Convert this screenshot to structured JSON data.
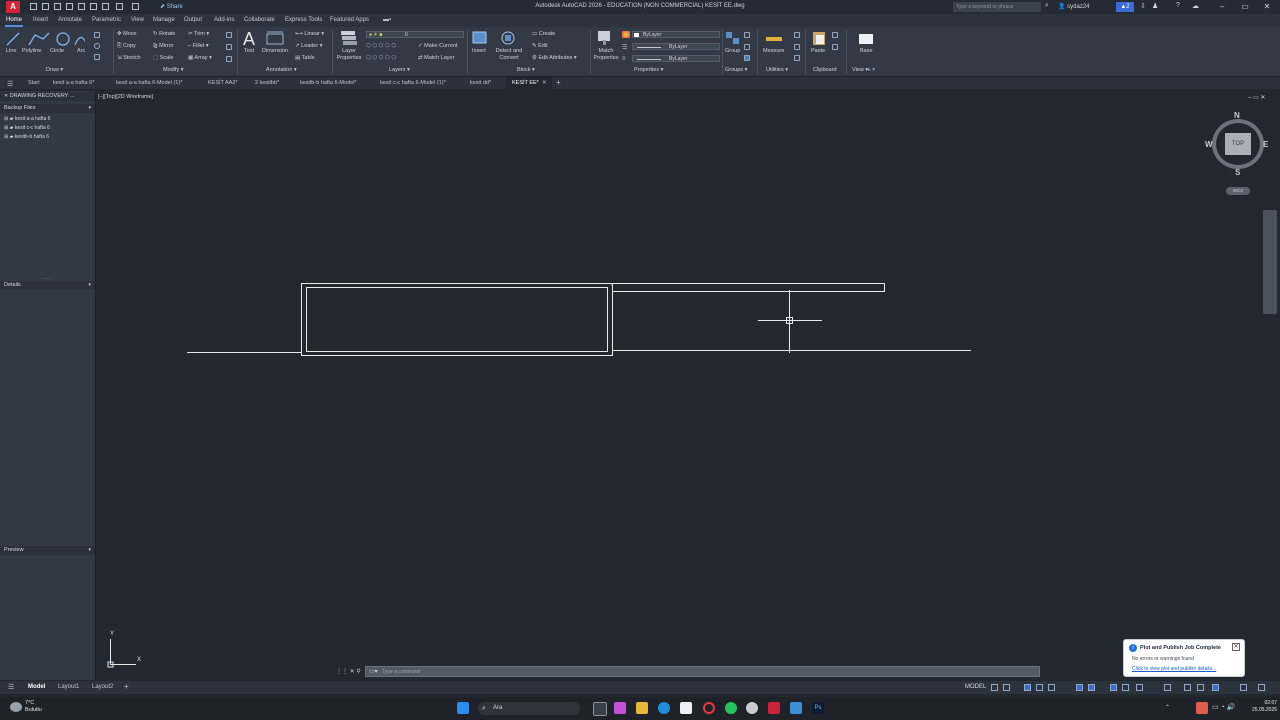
{
  "titlebar": {
    "title": "Autodesk AutoCAD 2026 - EDUCATION (NON COMMERCIAL)   KESİT EE.dwg",
    "share_label": "Share",
    "search_placeholder": "Type a keyword or phrase",
    "user": "sydaz24",
    "badge": "2"
  },
  "ribbon_tabs": [
    "Home",
    "Insert",
    "Annotate",
    "Parametric",
    "View",
    "Manage",
    "Output",
    "Add-ins",
    "Collaborate",
    "Express Tools",
    "Featured Apps"
  ],
  "ribbon": {
    "draw": {
      "line": "Line",
      "polyline": "Polyline",
      "circle": "Circle",
      "arc": "Arc",
      "panel": "Draw ▾"
    },
    "modify": {
      "move": "Move",
      "rotate": "Rotate",
      "trim": "Trim ▾",
      "copy": "Copy",
      "mirror": "Mirror",
      "fillet": "Fillet ▾",
      "stretch": "Stretch",
      "scale": "Scale",
      "array": "Array ▾",
      "panel": "Modify ▾"
    },
    "annotation": {
      "text": "Text",
      "dimension": "Dimension",
      "linear": "Linear ▾",
      "leader": "Leader ▾",
      "table": "Table",
      "panel": "Annotation ▾"
    },
    "layers": {
      "layer_properties": "Layer Properties",
      "layer_value": "0",
      "make_current": "Make Current",
      "match_layer": "Match Layer",
      "panel": "Layers ▾"
    },
    "block": {
      "insert": "Insert",
      "detect": "Detect and Convert",
      "create": "Create",
      "edit": "Edit",
      "edit_attributes": "Edit Attributes ▾",
      "panel": "Block ▾"
    },
    "properties": {
      "match": "Match Properties",
      "bylayer1": "ByLayer",
      "bylayer2": "ByLayer",
      "bylayer3": "ByLayer",
      "panel": "Properties ▾"
    },
    "groups": {
      "group": "Group",
      "panel": "Groups ▾"
    },
    "utilities": {
      "measure": "Measure",
      "panel": "Utilities ▾"
    },
    "clipboard": {
      "paste": "Paste",
      "panel": "Clipboard"
    },
    "view": {
      "base": "Base",
      "panel": "View ▾"
    }
  },
  "file_tabs": [
    "Start",
    "kesit a-a hafta 6*",
    "kesit a-a hafta 6-Model (1)*",
    "KESİT AA2*",
    "2 kesitbb*",
    "kesitb-b hafta 6-Model*",
    "kesit c-c hafta 6-Model (1)*",
    "kesit dd*",
    "KESİT EE*"
  ],
  "palette": {
    "title": "DRAWING RECOVERY ...",
    "backup_header": "Backup Files",
    "files": [
      "kesit a-a hafta 6",
      "kesit c-c hafta 6",
      "kesitb-b hafta 6"
    ],
    "details_header": "Details",
    "preview_header": "Preview"
  },
  "viewport": {
    "label": "[−][Top][2D Wireframe]"
  },
  "viewcube": {
    "n": "N",
    "s": "S",
    "e": "E",
    "w": "W",
    "top": "TOP",
    "wcs": "WCS"
  },
  "ucs": {
    "x": "X",
    "y": "Y"
  },
  "command": {
    "placeholder": "Type a command"
  },
  "layout_tabs": [
    "Model",
    "Layout1",
    "Layout2"
  ],
  "status": {
    "model": "MODEL"
  },
  "notification": {
    "title": "Plot and Publish Job Complete",
    "message": "No errors or warnings found",
    "link": "Click to view plot and publish details..."
  },
  "taskbar": {
    "weather_temp": "7°C",
    "weather_desc": "Bulutlu",
    "search": "Ara",
    "time": "02:07",
    "date": "25.05.2025"
  }
}
